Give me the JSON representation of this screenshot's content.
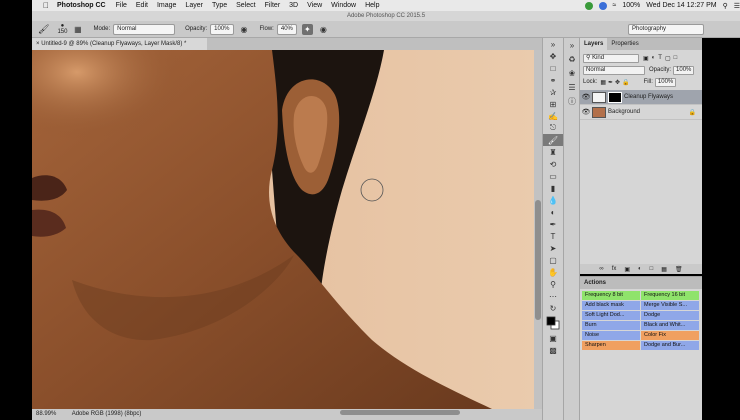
{
  "menubar": {
    "app_name": "Photoshop CC",
    "items": [
      "File",
      "Edit",
      "Image",
      "Layer",
      "Type",
      "Select",
      "Filter",
      "3D",
      "View",
      "Window",
      "Help"
    ],
    "battery": "100%",
    "datetime": "Wed Dec 14  12:27 PM"
  },
  "app_title": "Adobe Photoshop CC 2015.5",
  "options": {
    "brush_size": "150",
    "mode_label": "Mode:",
    "mode_value": "Normal",
    "opacity_label": "Opacity:",
    "opacity_value": "100%",
    "flow_label": "Flow:",
    "flow_value": "40%",
    "workspace": "Photography"
  },
  "document": {
    "tab_title": "Untitled-9 @ 89% (Cleanup Flyaways, Layer Mask/8) *"
  },
  "status": {
    "zoom": "88.99%",
    "profile": "Adobe RGB (1998) (8bpc)"
  },
  "layers_panel": {
    "tabs": [
      "Layers",
      "Properties"
    ],
    "kind": "Kind",
    "blend_mode": "Normal",
    "opacity_label": "Opacity:",
    "opacity_value": "100%",
    "lock_label": "Lock:",
    "fill_label": "Fill:",
    "fill_value": "100%",
    "layers": [
      {
        "name": "Cleanup Flyaways",
        "selected": true
      },
      {
        "name": "Background",
        "selected": false
      }
    ]
  },
  "actions_panel": {
    "title": "Actions",
    "buttons": [
      {
        "label": "Frequency 8 bit",
        "color": "#8fe36b"
      },
      {
        "label": "Frequency 16 bit",
        "color": "#8fe36b"
      },
      {
        "label": "Add black mask",
        "color": "#8fa7e8"
      },
      {
        "label": "Merge Visible S...",
        "color": "#8fa7e8"
      },
      {
        "label": "Soft Light Dod...",
        "color": "#8fa7e8"
      },
      {
        "label": "Dodge",
        "color": "#8fa7e8"
      },
      {
        "label": "Burn",
        "color": "#8fa7e8"
      },
      {
        "label": "Black and Whit...",
        "color": "#8fa7e8"
      },
      {
        "label": "Noise",
        "color": "#8fa7e8"
      },
      {
        "label": "Color Fix",
        "color": "#f0a060"
      },
      {
        "label": "Sharpen",
        "color": "#f0a060"
      },
      {
        "label": "Dodge and Bur...",
        "color": "#8fa7e8"
      }
    ]
  }
}
